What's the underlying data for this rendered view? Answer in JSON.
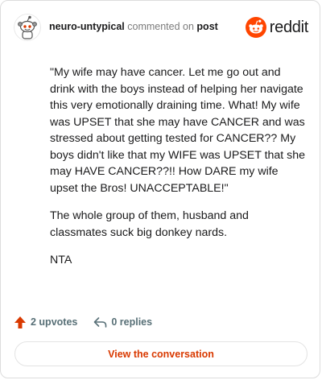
{
  "header": {
    "username": "neuro-untypical",
    "commented_on": "commented on",
    "post_link": "post",
    "brand": "reddit"
  },
  "colors": {
    "brand_orange": "#ff4500",
    "upvote_orange": "#d93900",
    "link_orange": "#d93900",
    "muted": "#7c7c7c"
  },
  "comment": {
    "paragraphs": [
      "\"My wife may have cancer. Let me go out and drink with the boys instead of helping her navigate this very emotionally draining time. What! My wife was UPSET that she may have CANCER and was stressed about getting tested for CANCER?? My boys didn't like that my WIFE was UPSET that she may HAVE CANCER??!! How DARE my wife upset the Bros! UNACCEPTABLE!\"",
      "The whole group of them, husband and classmates suck big donkey nards.",
      "NTA"
    ]
  },
  "actions": {
    "upvotes": "2 upvotes",
    "replies": "0 replies"
  },
  "cta": {
    "label": "View the conversation"
  },
  "icons": {
    "avatar": "snoo-avatar-icon",
    "logo": "reddit-logo-icon",
    "upvote": "upvote-arrow-icon",
    "reply": "reply-arrow-icon"
  }
}
